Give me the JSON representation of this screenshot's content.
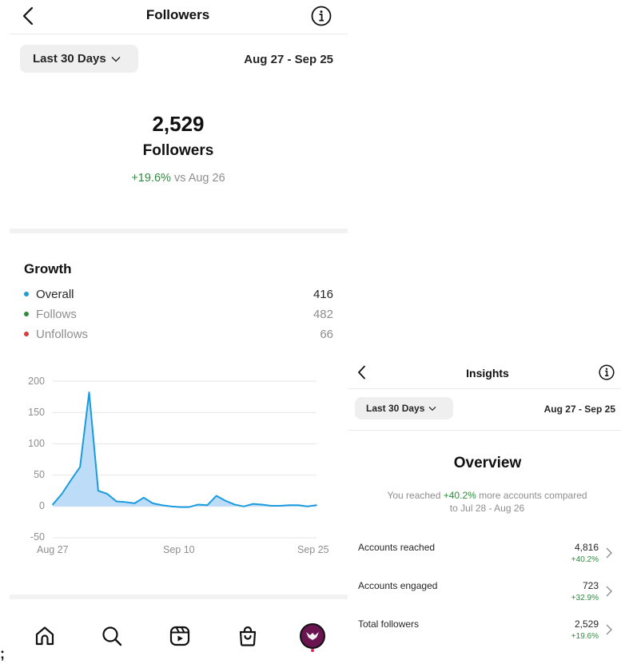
{
  "left": {
    "header": {
      "title": "Followers"
    },
    "range": {
      "label": "Last 30 Days",
      "dates": "Aug 27 - Sep 25"
    },
    "summary": {
      "count": "2,529",
      "label": "Followers",
      "change": "+19.6%",
      "change_suffix": "vs Aug 26"
    },
    "growth": {
      "title": "Growth",
      "legend": [
        {
          "label": "Overall",
          "value": "416",
          "color": "#1a9be0"
        },
        {
          "label": "Follows",
          "value": "482",
          "color": "#2e8b3e"
        },
        {
          "label": "Unfollows",
          "value": "66",
          "color": "#d93a3a"
        }
      ]
    },
    "chart_data": {
      "type": "area",
      "title": "",
      "xlabel": "",
      "ylabel": "",
      "ylim": [
        -50,
        200
      ],
      "yticks": [
        "200",
        "150",
        "100",
        "50",
        "0",
        "-50"
      ],
      "xtick_labels": [
        "Aug 27",
        "Sep 10",
        "Sep 25"
      ],
      "x": [
        "Aug 27",
        "Aug 28",
        "Aug 29",
        "Aug 30",
        "Aug 31",
        "Sep 1",
        "Sep 2",
        "Sep 3",
        "Sep 4",
        "Sep 5",
        "Sep 6",
        "Sep 7",
        "Sep 8",
        "Sep 9",
        "Sep 10",
        "Sep 11",
        "Sep 12",
        "Sep 13",
        "Sep 14",
        "Sep 15",
        "Sep 16",
        "Sep 17",
        "Sep 18",
        "Sep 19",
        "Sep 20",
        "Sep 21",
        "Sep 22",
        "Sep 23",
        "Sep 24",
        "Sep 25"
      ],
      "series": [
        {
          "values": [
            3,
            20,
            42,
            63,
            182,
            25,
            20,
            8,
            7,
            5,
            14,
            5,
            2,
            0,
            -1,
            -1,
            3,
            2,
            17,
            9,
            3,
            0,
            4,
            3,
            1,
            1,
            2,
            2,
            0,
            2
          ]
        }
      ],
      "grid": true,
      "color": "#1a9be0",
      "fill": "#bcdcf7"
    },
    "nav": [
      "home-icon",
      "search-icon",
      "reels-icon",
      "shop-icon",
      "profile-avatar"
    ]
  },
  "right": {
    "header": {
      "title": "Insights"
    },
    "range": {
      "label": "Last 30 Days",
      "dates": "Aug 27 - Sep 25"
    },
    "overview": {
      "title": "Overview",
      "line1_pre": "You reached",
      "line1_highlight": "+40.2%",
      "line1_post": "more accounts compared",
      "line2": "to Jul 28 - Aug 26"
    },
    "rows": [
      {
        "label": "Accounts reached",
        "value": "4,816",
        "change": "+40.2%"
      },
      {
        "label": "Accounts engaged",
        "value": "723",
        "change": "+32.9%"
      },
      {
        "label": "Total followers",
        "value": "2,529",
        "change": "+19.6%"
      }
    ]
  },
  "bottom_fragment": ";"
}
